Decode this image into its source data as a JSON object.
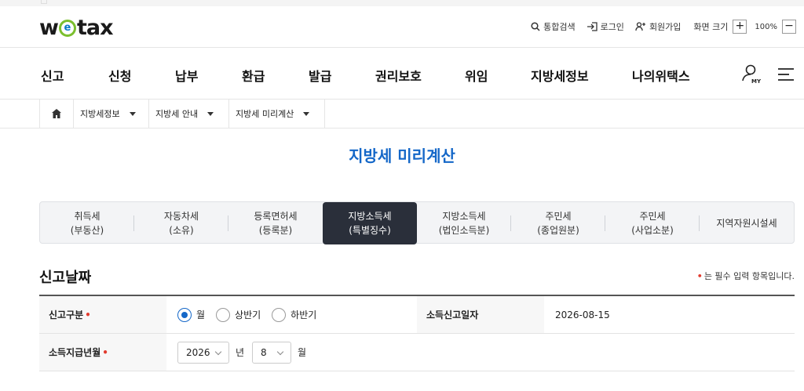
{
  "logo": {
    "pre": "w",
    "e": "e",
    "post": "tax"
  },
  "util": {
    "search": "통합검색",
    "login": "로그인",
    "join": "회원가입",
    "screen_size": "화면 크기",
    "zoom_in": "+",
    "zoom_level": "100%",
    "zoom_out": "−"
  },
  "gnb": [
    "신고",
    "신청",
    "납부",
    "환급",
    "발급",
    "권리보호",
    "위임",
    "지방세정보",
    "나의위택스"
  ],
  "breadcrumb": [
    "지방세정보",
    "지방세 안내",
    "지방세 미리계산"
  ],
  "page_title": "지방세 미리계산",
  "tabs": [
    {
      "l1": "취득세",
      "l2": "(부동산)"
    },
    {
      "l1": "자동차세",
      "l2": "(소유)"
    },
    {
      "l1": "등록면허세",
      "l2": "(등록분)"
    },
    {
      "l1": "지방소득세",
      "l2": "(특별징수)"
    },
    {
      "l1": "지방소득세",
      "l2": "(법인소득분)"
    },
    {
      "l1": "주민세",
      "l2": "(종업원분)"
    },
    {
      "l1": "주민세",
      "l2": "(사업소분)"
    },
    {
      "l1": "지역자원시설세",
      "l2": ""
    }
  ],
  "active_tab": 3,
  "section_title": "신고날짜",
  "required_note": "는 필수 입력 항목입니다.",
  "required_mark": "•",
  "form": {
    "report_type_label": "신고구분",
    "report_type_options": [
      "월",
      "상반기",
      "하반기"
    ],
    "report_type_selected": "월",
    "report_date_label": "소득신고일자",
    "report_date_value": "2026-08-15",
    "pay_month_label": "소득지급년월",
    "year_value": "2026",
    "year_unit": "년",
    "month_value": "8",
    "month_unit": "월"
  },
  "colors": {
    "accent": "#1467c8",
    "active_tab_bg": "#2a2f3a",
    "required": "#e23b2e",
    "logo_ring": "#7bbf2e"
  }
}
